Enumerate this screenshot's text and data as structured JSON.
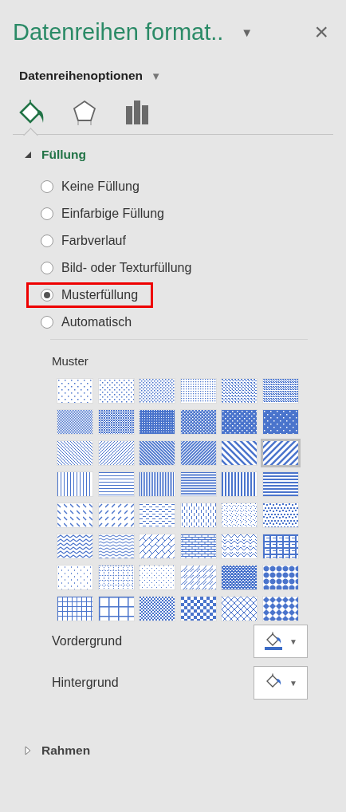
{
  "pane": {
    "title": "Datenreihen format..",
    "menu_caret": "▼",
    "close": "×"
  },
  "options_menu": {
    "label": "Datenreihenoptionen",
    "caret": "▼"
  },
  "icon_tabs": [
    {
      "kind": "fill",
      "selected": true
    },
    {
      "kind": "effects",
      "selected": false
    },
    {
      "kind": "series",
      "selected": false
    }
  ],
  "sections": [
    {
      "title": "Füllung",
      "expanded": true
    },
    {
      "title": "Rahmen",
      "expanded": false
    }
  ],
  "fill_options": [
    {
      "label": "Keine Füllung",
      "selected": false,
      "highlighted": false
    },
    {
      "label": "Einfarbige Füllung",
      "selected": false,
      "highlighted": false
    },
    {
      "label": "Farbverlauf",
      "selected": false,
      "highlighted": false
    },
    {
      "label": "Bild- oder Texturfüllung",
      "selected": false,
      "highlighted": false
    },
    {
      "label": "Musterfüllung",
      "selected": true,
      "highlighted": true
    },
    {
      "label": "Automatisch",
      "selected": false,
      "highlighted": false
    }
  ],
  "pattern_label": "Muster",
  "patterns": [
    {
      "kind": "pct5",
      "selected": false
    },
    {
      "kind": "pct10",
      "selected": false
    },
    {
      "kind": "pct20",
      "selected": false
    },
    {
      "kind": "pct25",
      "selected": false
    },
    {
      "kind": "pct30",
      "selected": false
    },
    {
      "kind": "pct40",
      "selected": false
    },
    {
      "kind": "pct50",
      "selected": false
    },
    {
      "kind": "pct60",
      "selected": false
    },
    {
      "kind": "pct70",
      "selected": false
    },
    {
      "kind": "pct75",
      "selected": false
    },
    {
      "kind": "pct80",
      "selected": false
    },
    {
      "kind": "pct90",
      "selected": false
    },
    {
      "kind": "ltDnDiag",
      "selected": false
    },
    {
      "kind": "ltUpDiag",
      "selected": false
    },
    {
      "kind": "dkDnDiag",
      "selected": false
    },
    {
      "kind": "dkUpDiag",
      "selected": false
    },
    {
      "kind": "wdDnDiag",
      "selected": false
    },
    {
      "kind": "wdUpDiag",
      "selected": true
    },
    {
      "kind": "ltVert",
      "selected": false
    },
    {
      "kind": "ltHorz",
      "selected": false
    },
    {
      "kind": "narVert",
      "selected": false
    },
    {
      "kind": "narHorz",
      "selected": false
    },
    {
      "kind": "dkVert",
      "selected": false
    },
    {
      "kind": "dkHorz",
      "selected": false
    },
    {
      "kind": "dashDnDiag",
      "selected": false
    },
    {
      "kind": "dashUpDiag",
      "selected": false
    },
    {
      "kind": "dashHorz",
      "selected": false
    },
    {
      "kind": "dashVert",
      "selected": false
    },
    {
      "kind": "smConfetti",
      "selected": false
    },
    {
      "kind": "lgConfetti",
      "selected": false
    },
    {
      "kind": "zigZag",
      "selected": false
    },
    {
      "kind": "wave",
      "selected": false
    },
    {
      "kind": "diagBrick",
      "selected": false
    },
    {
      "kind": "horzBrick",
      "selected": false
    },
    {
      "kind": "weave",
      "selected": false
    },
    {
      "kind": "plaid",
      "selected": false
    },
    {
      "kind": "divot",
      "selected": false
    },
    {
      "kind": "dotGrid",
      "selected": false
    },
    {
      "kind": "dotDmnd",
      "selected": false
    },
    {
      "kind": "shingle",
      "selected": false
    },
    {
      "kind": "trellis",
      "selected": false
    },
    {
      "kind": "sphere",
      "selected": false
    },
    {
      "kind": "smGrid",
      "selected": false
    },
    {
      "kind": "lgGrid",
      "selected": false
    },
    {
      "kind": "smCheck",
      "selected": false
    },
    {
      "kind": "lgCheck",
      "selected": false
    },
    {
      "kind": "openDmnd",
      "selected": false
    },
    {
      "kind": "solidDmnd",
      "selected": false
    }
  ],
  "color_pickers": [
    {
      "label": "Vordergrund",
      "color": "#3b6cc7",
      "caret": "▼"
    },
    {
      "label": "Hintergrund",
      "caret": "▼"
    }
  ]
}
